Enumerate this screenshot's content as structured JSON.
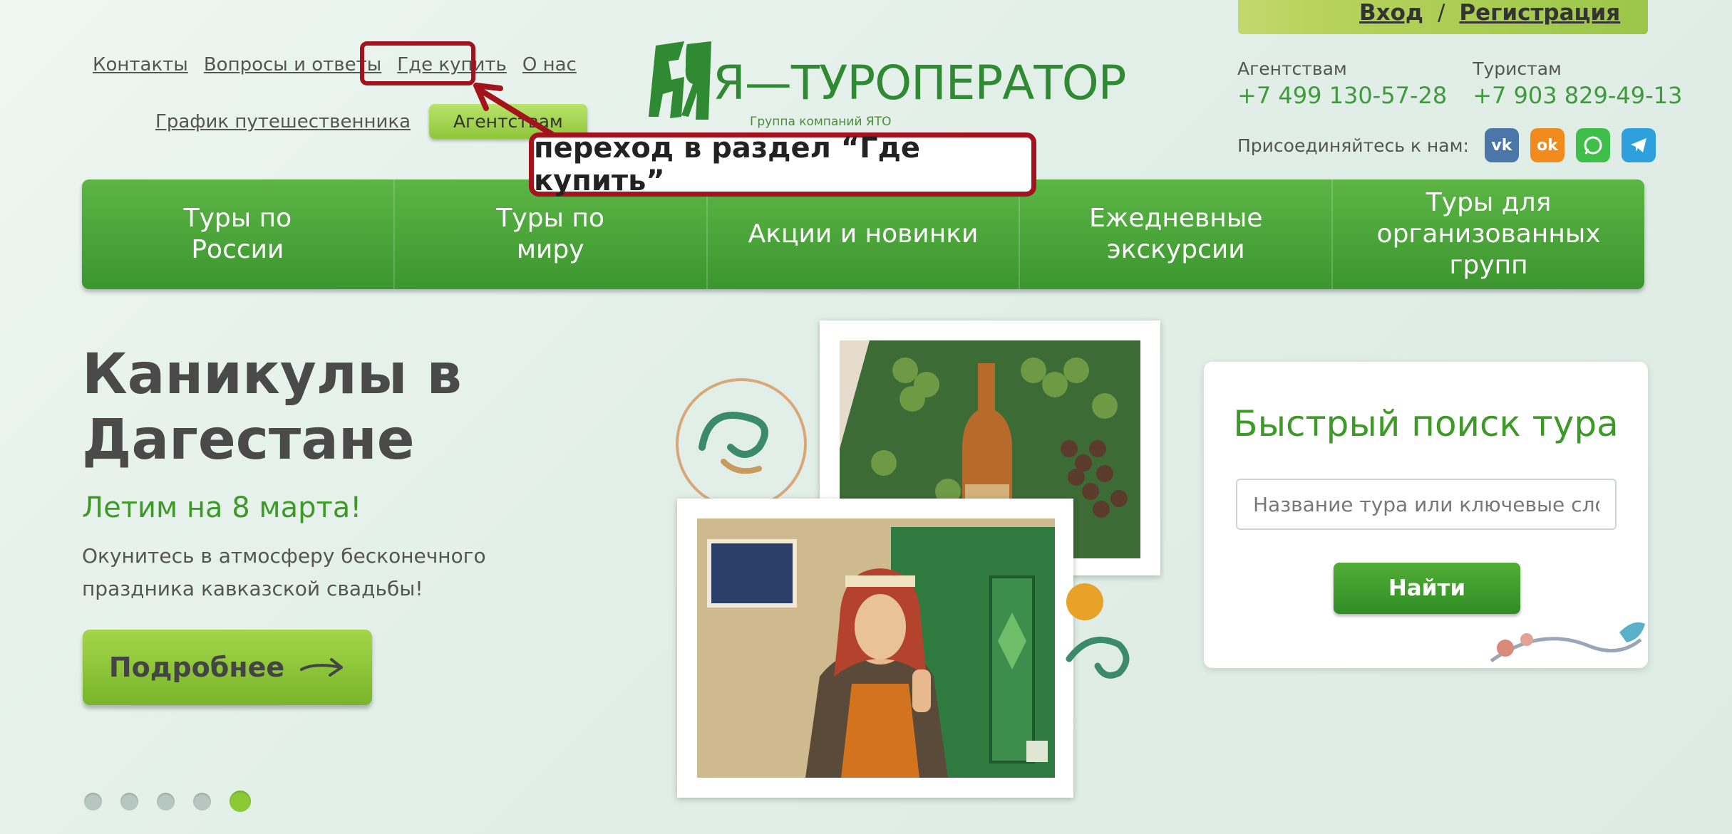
{
  "header": {
    "top_links": [
      "Контакты",
      "Вопросы и ответы",
      "Где купить",
      "О нас"
    ],
    "traveler_schedule": "График путешественника",
    "agencies_button": "Агентствам",
    "logo_text": "Я—ТУРОПЕРАТОР",
    "logo_sub": "Группа компаний ЯТО",
    "login": "Вход",
    "separator": "/",
    "register": "Регистрация",
    "phones": [
      {
        "label": "Агентствам",
        "number": "+7 499 130-57-28"
      },
      {
        "label": "Туристам",
        "number": "+7 903 829-49-13"
      }
    ],
    "social_label": "Присоединяйтесь к нам:",
    "social_icons": [
      {
        "name": "vk-icon",
        "color": "#4a76a8",
        "glyph": "vk"
      },
      {
        "name": "odnoklassniki-icon",
        "color": "#f28b1d",
        "glyph": "ok"
      },
      {
        "name": "whatsapp-icon",
        "color": "#3fbf4a",
        "glyph": "w"
      },
      {
        "name": "telegram-icon",
        "color": "#2ea0db",
        "glyph": "t"
      }
    ]
  },
  "callout": {
    "text": "переход в раздел “Где купить”",
    "color": "#a3131e"
  },
  "nav": [
    "Туры по России",
    "Туры по миру",
    "Акции и новинки",
    "Ежедневные экскурсии",
    "Туры для организованных групп"
  ],
  "hero": {
    "title": "Каникулы в Дагестане",
    "subtitle": "Летим на 8 марта!",
    "description": "Окунитесь в атмосферу бесконечного праздника кавказской свадьбы!",
    "button": "Подробнее",
    "slides_count": 5,
    "active_slide": 5
  },
  "search": {
    "title": "Быстрый поиск тура",
    "placeholder": "Название тура или ключевые слова",
    "button": "Найти"
  },
  "colors": {
    "brand_green": "#3e9a3c",
    "accent_red": "#a3131e",
    "light_green": "#8dc935"
  }
}
